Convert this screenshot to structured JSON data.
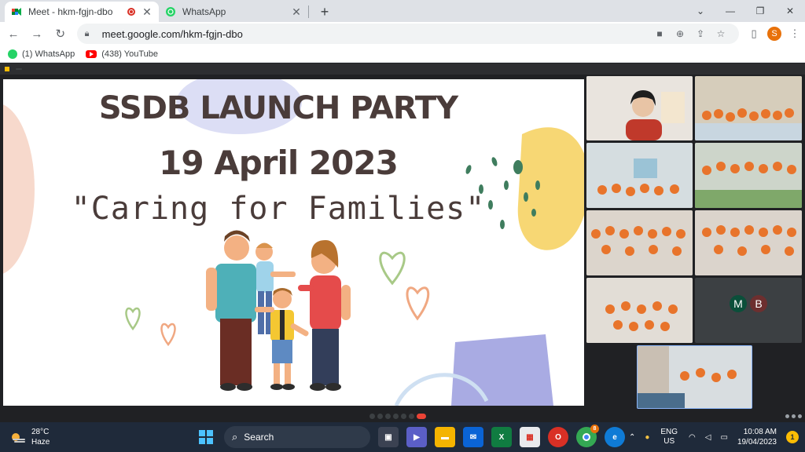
{
  "browser": {
    "tabs": [
      {
        "title": "Meet - hkm-fgjn-dbo",
        "active": true,
        "recording": true
      },
      {
        "title": "WhatsApp",
        "active": false
      }
    ],
    "address": {
      "url": "meet.google.com/hkm-fgjn-dbo"
    },
    "profile_initial": "S",
    "bookmarks": [
      {
        "label": "(1) WhatsApp"
      },
      {
        "label": "(438) YouTube"
      }
    ]
  },
  "slide": {
    "title": "SSDB LAUNCH PARTY",
    "date": "19 April 2023",
    "tagline": "\"Caring for Families\""
  },
  "participants": {
    "avatars": [
      {
        "initial": "M",
        "color": "#0b4f3a"
      },
      {
        "initial": "B",
        "color": "#6d2f2f"
      }
    ]
  },
  "taskbar": {
    "weather_temp": "28°C",
    "weather_desc": "Haze",
    "search_label": "Search",
    "lang_top": "ENG",
    "lang_bottom": "US",
    "time": "10:08 AM",
    "date": "19/04/2023",
    "notifications": "1",
    "chrome_badge": "8"
  }
}
